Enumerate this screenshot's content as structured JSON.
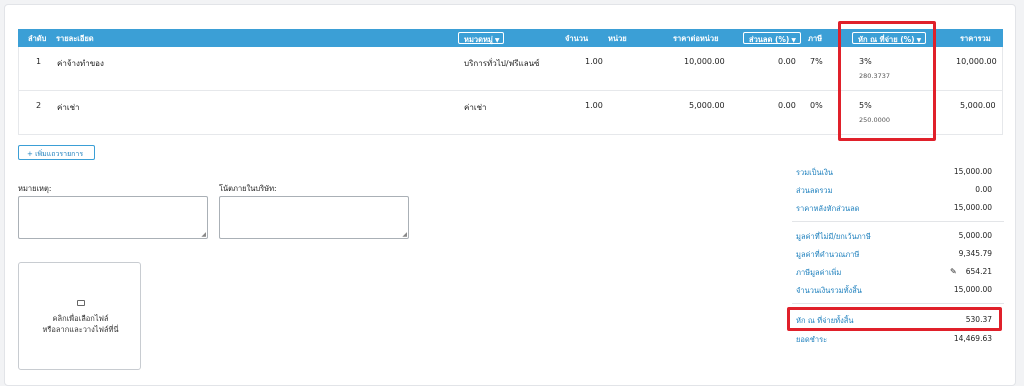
{
  "table": {
    "headers": {
      "seq": "ลำดับ",
      "detail": "รายละเอียด",
      "category": "หมวดหมู่",
      "qty": "จำนวน",
      "unit": "หน่วย",
      "unit_price": "ราคาต่อหน่วย",
      "discount": "ส่วนลด (%)",
      "tax": "ภาษี",
      "withholding": "หัก ณ ที่จ่าย (%)",
      "total": "ราคารวม"
    },
    "rows": [
      {
        "seq": "1",
        "detail": "ค่าจ้างทำของ",
        "category": "บริการทั่วไป/ฟรีแลนซ์",
        "qty": "1.00",
        "unit_price": "10,000.00",
        "discount": "0.00",
        "tax": "7%",
        "withholding": "3%",
        "withholding_amount": "280.3737",
        "total": "10,000.00"
      },
      {
        "seq": "2",
        "detail": "ค่าเช่า",
        "category": "ค่าเช่า",
        "qty": "1.00",
        "unit_price": "5,000.00",
        "discount": "0.00",
        "tax": "0%",
        "withholding": "5%",
        "withholding_amount": "250.0000",
        "total": "5,000.00"
      }
    ]
  },
  "add_row_button": "+ เพิ่มแถวรายการ",
  "notes": {
    "remark_label": "หมายเหตุ:",
    "internal_label": "โน้ตภายในบริษัท:"
  },
  "upload": {
    "line1": "คลิกเพื่อเลือกไฟล์",
    "line2": "หรือลากและวางไฟล์ที่นี่"
  },
  "summary": {
    "subtotal_label": "รวมเป็นเงิน",
    "subtotal": "15,000.00",
    "discount_label": "ส่วนลดรวม",
    "discount": "0.00",
    "after_discount_label": "ราคาหลังหักส่วนลด",
    "after_discount": "15,000.00",
    "non_vat_label": "มูลค่าที่ไม่มี/ยกเว้นภาษี",
    "non_vat": "5,000.00",
    "vatable_label": "มูลค่าที่คำนวณภาษี",
    "vatable": "9,345.79",
    "vat_label": "ภาษีมูลค่าเพิ่ม",
    "vat": "654.21",
    "grand_total_label": "จำนวนเงินรวมทั้งสิ้น",
    "grand_total": "15,000.00",
    "withholding_total_label": "หัก ณ ที่จ่ายทั้งสิ้น",
    "withholding_total": "530.37",
    "payable_label": "ยอดชำระ",
    "payable": "14,469.63"
  },
  "colors": {
    "header_bg": "#3b9fd6",
    "link_blue": "#1c7fbd",
    "highlight_red": "#e0202a"
  }
}
